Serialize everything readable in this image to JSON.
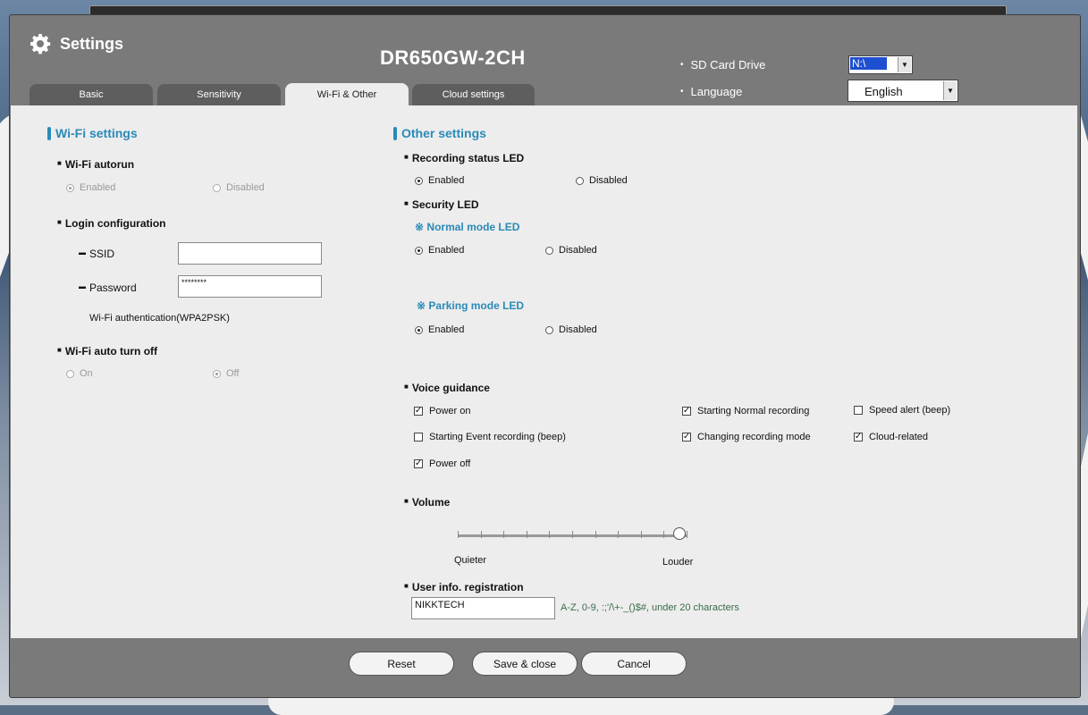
{
  "window": {
    "title": "Settings",
    "model": "DR650GW-2CH"
  },
  "header": {
    "sd_card_label": "SD Card Drive",
    "sd_card_value": "N:\\",
    "language_label": "Language",
    "language_value": "English"
  },
  "tabs": [
    "Basic",
    "Sensitivity",
    "Wi-Fi & Other",
    "Cloud settings"
  ],
  "active_tab": "Wi-Fi & Other",
  "wifi": {
    "title": "Wi-Fi settings",
    "autorun_label": "Wi-Fi autorun",
    "autorun_enabled": "Enabled",
    "autorun_disabled": "Disabled",
    "login_label": "Login configuration",
    "ssid_label": "SSID",
    "ssid_value": "",
    "password_label": "Password",
    "password_value": "********",
    "auth_text": "Wi-Fi authentication(WPA2PSK)",
    "auto_off_label": "Wi-Fi auto turn off",
    "auto_off_on": "On",
    "auto_off_off": "Off"
  },
  "other": {
    "title": "Other settings",
    "rec_led_label": "Recording status LED",
    "enabled": "Enabled",
    "disabled": "Disabled",
    "security_led_label": "Security LED",
    "normal_led_label": "Normal mode LED",
    "parking_led_label": "Parking mode LED",
    "voice_label": "Voice guidance",
    "voice": {
      "power_on": "Power on",
      "start_event": "Starting Event recording (beep)",
      "power_off": "Power off",
      "start_normal": "Starting Normal recording",
      "change_mode": "Changing recording mode",
      "speed_alert": "Speed alert (beep)",
      "cloud": "Cloud-related"
    },
    "volume_label": "Volume",
    "volume_level": 1.0,
    "quieter": "Quieter",
    "louder": "Louder",
    "user_info_label": "User info. registration",
    "user_info_value": "NIKKTECH",
    "user_info_hint": "A-Z, 0-9, :;'/\\+-_()$#, under 20 characters"
  },
  "footer": {
    "reset": "Reset",
    "save": "Save & close",
    "cancel": "Cancel"
  },
  "icons": {
    "settings": "gear-icon",
    "note": "reference-mark-icon"
  },
  "colors": {
    "accent": "#2a8ab8",
    "hint": "#3b6b4a",
    "chrome": "#7a7a7a",
    "panel": "#ededed"
  }
}
